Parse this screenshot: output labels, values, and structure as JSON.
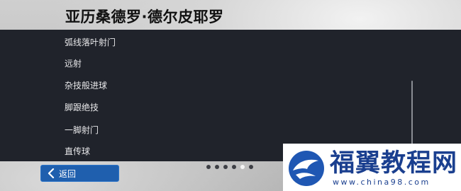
{
  "header": {
    "player_name": "亚历桑德罗·德尔皮耶罗"
  },
  "skills": {
    "items": [
      {
        "label": "弧线落叶射门"
      },
      {
        "label": "远射"
      },
      {
        "label": "杂技般进球"
      },
      {
        "label": "脚跟绝技"
      },
      {
        "label": "一脚射门"
      },
      {
        "label": "直传球"
      }
    ]
  },
  "footer": {
    "back_label": "返回",
    "pager": {
      "total": 6,
      "current": 5
    }
  },
  "watermark": {
    "title": "福翼教程网",
    "url": "www.china98.com"
  },
  "colors": {
    "panel": "#20232b",
    "back_button": "#1f5fae",
    "watermark_blue": "#1a3f8f"
  },
  "icons": {
    "back": "chevron-left-icon",
    "logo": "eagle-logo-icon"
  }
}
